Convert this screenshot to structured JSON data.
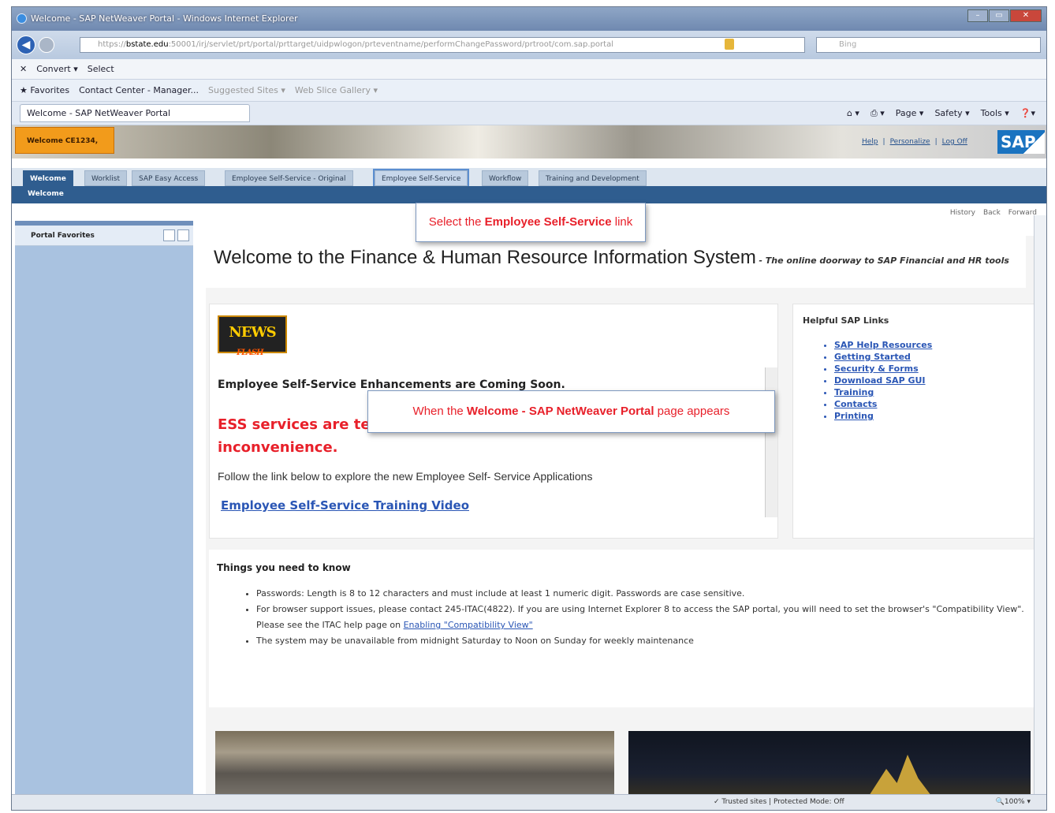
{
  "window": {
    "title": "Welcome - SAP NetWeaver Portal - Windows Internet Explorer",
    "buttons": [
      "–",
      "▭",
      "✕"
    ]
  },
  "address": {
    "url_prefix": "https://",
    "url_host": "bstate.edu",
    "url_rest": ":50001/irj/servlet/prt/portal/prttarget/uidpwlogon/prteventname/performChangePassword/prtroot/com.sap.portal",
    "search_placeholder": "Bing"
  },
  "command_bar": {
    "convert": "Convert ▾",
    "select": "Select"
  },
  "favorites_bar": {
    "favorites": "Favorites",
    "items": [
      "Contact Center - Manager...",
      "Suggested Sites ▾",
      "Web Slice Gallery ▾"
    ]
  },
  "tab_bar": {
    "tab_title": "Welcome - SAP NetWeaver Portal",
    "tools": [
      "Page ▾",
      "Safety ▾",
      "Tools ▾"
    ]
  },
  "portal": {
    "welcome_user": "Welcome CE1234,",
    "header_links": [
      "Help",
      "Personalize",
      "Log Off"
    ],
    "sap_logo": "SAP",
    "nav_tabs": [
      "Welcome",
      "Worklist",
      "SAP Easy Access",
      "Employee Self-Service - Original",
      "Employee Self-Service",
      "Workflow",
      "Training and Development"
    ],
    "sub_nav": "Welcome",
    "history": [
      "History",
      "Back",
      "Forward"
    ],
    "left_panel_title": "Portal Favorites"
  },
  "tooltips": {
    "t1_a": "Select the ",
    "t1_b": "Employee Self-Service",
    "t1_c": " link",
    "t2_a": "When the ",
    "t2_b": "Welcome - SAP NetWeaver Portal",
    "t2_c": " page appears"
  },
  "main": {
    "welcome_title": "Welcome to the Finance & Human Resource Information System",
    "welcome_sub": "- The online doorway to SAP Financial and HR tools",
    "news_logo": "NEWS",
    "news_logo_sub": "FLASH",
    "news_heading": "Employee Self-Service Enhancements are Coming Soon.",
    "ess_line1": "ESS services are te",
    "ess_line2": "inconvenience.",
    "follow_text": "Follow the link below to explore the new Employee Self- Service Applications",
    "video_link": "Employee Self-Service Training Video",
    "links_title": "Helpful SAP Links",
    "links": [
      "SAP Help Resources",
      "Getting Started",
      "Security & Forms",
      "Download SAP GUI",
      "Training",
      "Contacts",
      "Printing"
    ],
    "things_title": "Things you need to know",
    "things_1": "Passwords: Length is 8 to 12 characters and must include at least 1 numeric digit.  Passwords are case sensitive.",
    "things_2a": "For browser support issues, please contact 245-ITAC(4822). If you are using Internet Explorer 8 to access the SAP portal, you will need to set the browser's \"Compatibility View\".  Please see the ITAC help page on ",
    "things_2b": "Enabling \"Compatibility View\"",
    "things_3": "The system may be unavailable from midnight Saturday to Noon on Sunday for weekly maintenance"
  },
  "statusbar": {
    "mode": "✓ Trusted sites | Protected Mode: Off",
    "zoom": "🔍100% ▾"
  }
}
